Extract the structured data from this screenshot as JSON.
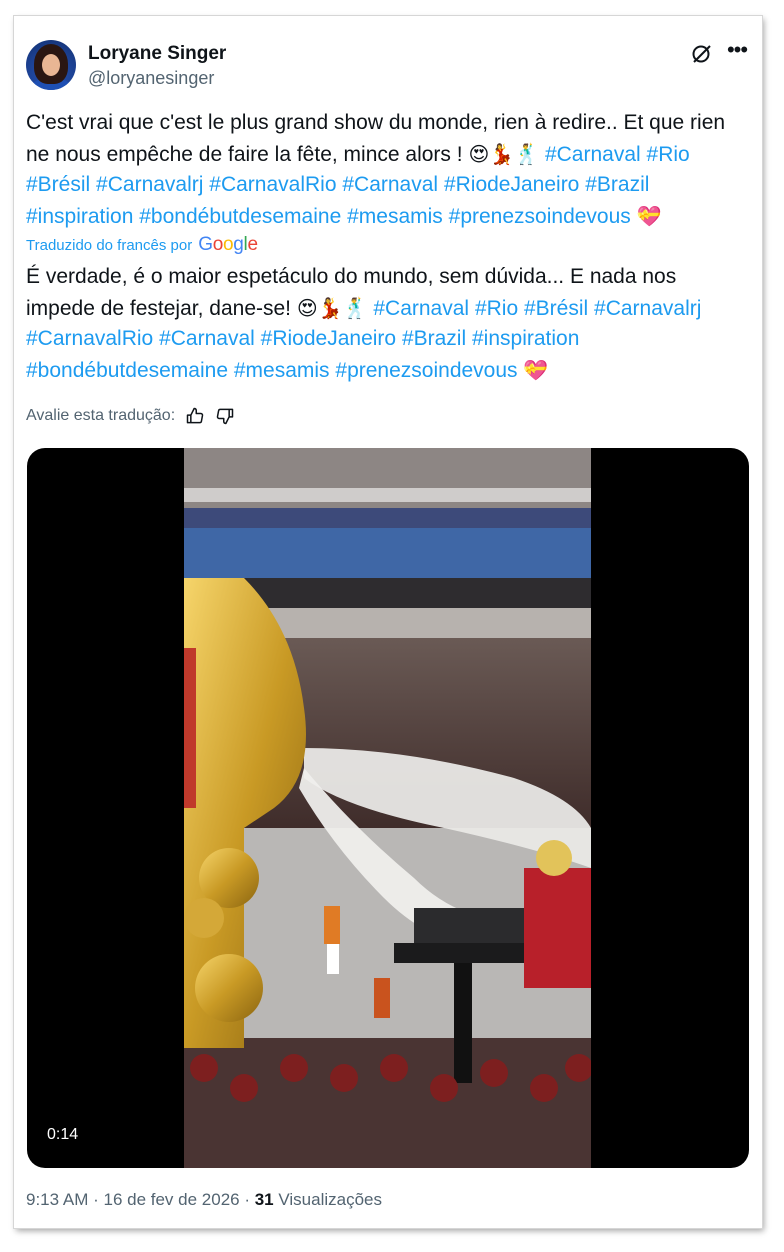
{
  "user": {
    "name": "Loryane Singer",
    "handle": "@loryanesinger"
  },
  "tweet": {
    "text_plain": "C'est vrai que c'est le plus grand show du monde, rien à redire.. Et que rien ne nous empêche de faire la fête, mince alors !",
    "emojis": "😍💃🕺",
    "hashtags": [
      "#Carnaval",
      "#Rio",
      "#Brésil",
      "#Carnavalrj",
      "#CarnavalRio",
      "#Carnaval",
      "#RiodeJaneiro",
      "#Brazil",
      "#inspiration",
      "#bondébutdesemaine",
      "#mesamis",
      "#prenezsoindevous"
    ],
    "end_emoji": "💝"
  },
  "translation": {
    "label": "Traduzido do francês por",
    "provider": "Google",
    "text_plain": "É verdade, é o maior espetáculo do mundo, sem dúvida... E nada nos impede de festejar, dane-se!",
    "emojis": "😍💃🕺",
    "hashtags": [
      "#Carnaval",
      "#Rio",
      "#Brésil",
      "#Carnavalrj",
      "#CarnavalRio",
      "#Carnaval",
      "#RiodeJaneiro",
      "#Brazil",
      "#inspiration",
      "#bondébutdesemaine",
      "#mesamis",
      "#prenezsoindevous"
    ],
    "end_emoji": "💝",
    "rate_label": "Avalie esta tradução:"
  },
  "video": {
    "duration": "0:14"
  },
  "footer": {
    "time": "9:13 AM",
    "sep1": " · ",
    "date": "16 de fev de 2026",
    "sep2": " · ",
    "views_count": "31",
    "views_label": "Visualizações"
  },
  "icons": {
    "grok": "grok-icon",
    "more": "more-icon",
    "thumbs_up": "thumbs-up-icon",
    "thumbs_down": "thumbs-down-icon"
  },
  "colors": {
    "link": "#1d9bf0",
    "secondary": "#536471",
    "text": "#0f1419"
  }
}
